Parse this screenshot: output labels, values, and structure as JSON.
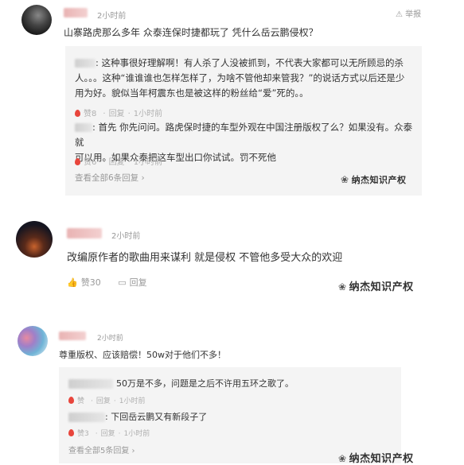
{
  "comments": [
    {
      "time": "2小时前",
      "report": "举报",
      "text": "山寨路虎那么多年 众泰连保时捷都玩了 凭什么岳云鹏侵权？",
      "replies": [
        {
          "text": ": 这种事很好理解啊！有人杀了人没被抓到，不代表大家都可以无所顾忌的杀人。。。这种“谁谁谁也怎样怎样了，为啥不管他却来管我？”的说话方式以后还是少用为好。貌似当年柯震东也是被这样的粉丝给“爱”死的。。",
          "line1": ": 这种事很好理解啊！有人杀了人没被抓到，不代表大家都可以无所顾忌的杀",
          "line2": "人。。。这种“谁谁谁也怎样怎样了，为啥不管他却来管我？”的说话方式以后还是少",
          "line3": "用为好。貌似当年柯震东也是被这样的粉丝给“爱”死的。。",
          "likes": "赞8",
          "reply": "回复",
          "time": "1小时前"
        },
        {
          "line1": ": 首先 你先问问。路虎保时捷的车型外观在中国注册版权了么？如果没有。众泰就",
          "line2": "可以用。如果众泰把这车型出口你试试。罚不死他",
          "likes": "赞6",
          "reply": "回复",
          "time": "1小时前"
        }
      ],
      "see_all": "查看全部6条回复 ›"
    },
    {
      "time": "2小时前",
      "text": "改编原作者的歌曲用来谋利 就是侵权 不管他多受大众的欢迎",
      "likes": "赞30",
      "reply": "回复"
    },
    {
      "time": "2小时前",
      "text": "尊重版权、应该赔偿！50w对于他们不多！",
      "replies": [
        {
          "text": "50万是不多，问题是之后不许用五环之歌了。",
          "likes": "赞",
          "reply": "回复",
          "time": "1小时前"
        },
        {
          "text": ": 下回岳云鹏又有新段子了",
          "likes": "赞3",
          "reply": "回复",
          "time": "1小时前"
        }
      ],
      "see_all": "查看全部5条回复 ›"
    }
  ],
  "watermark": "纳杰知识产权",
  "colors": {
    "flame": "#e8453c",
    "reply_bg": "#f4f4f4",
    "meta": "#999999",
    "name_blur": "#e9b3b3"
  }
}
